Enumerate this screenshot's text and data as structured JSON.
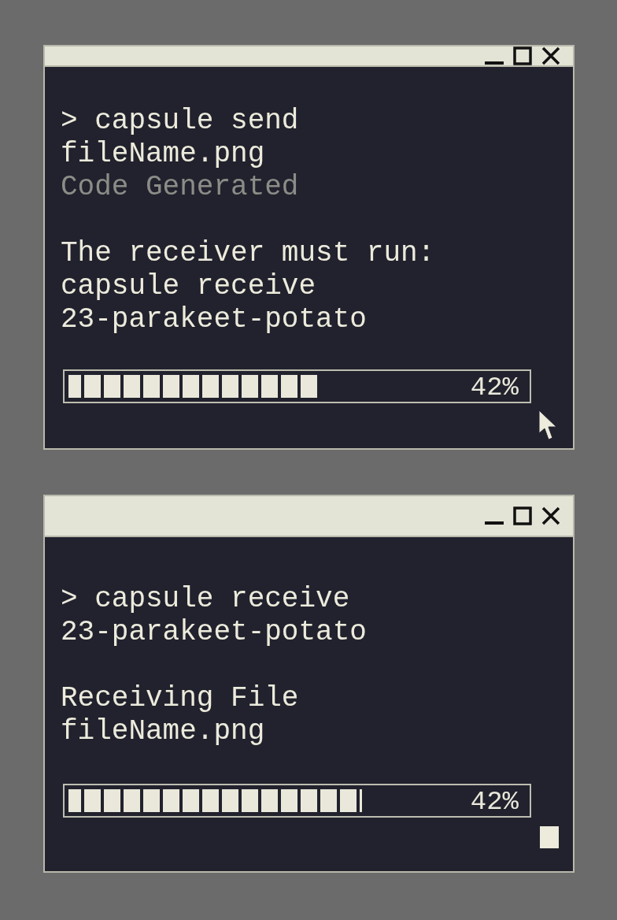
{
  "windows": [
    {
      "blocks": [
        [
          {
            "text": "> capsule send",
            "dimmed": false
          },
          {
            "text": "fileName.png",
            "dimmed": false
          },
          {
            "text": "Code Generated",
            "dimmed": true
          }
        ],
        [
          {
            "text": "The receiver must run:",
            "dimmed": false
          },
          {
            "text": "capsule receive",
            "dimmed": false
          },
          {
            "text": "23-parakeet-potato",
            "dimmed": false
          }
        ]
      ],
      "progress": {
        "level": 0.55,
        "reading": "42%"
      },
      "kind": "pointer"
    },
    {
      "blocks": [
        [
          {
            "text": "> capsule receive",
            "dimmed": false
          },
          {
            "text": "23-parakeet-potato",
            "dimmed": false
          }
        ],
        [
          {
            "text": "Receiving File",
            "dimmed": false
          },
          {
            "text": "fileName.png",
            "dimmed": false
          }
        ]
      ],
      "progress": {
        "level": 0.64,
        "reading": "42%"
      },
      "kind": "block"
    }
  ]
}
